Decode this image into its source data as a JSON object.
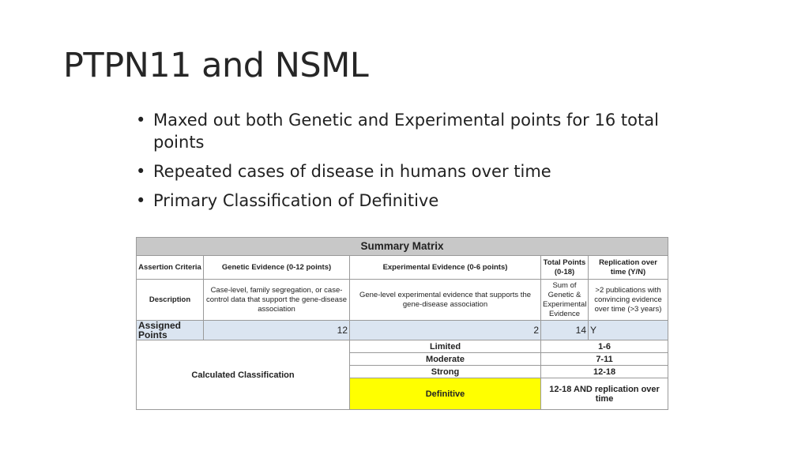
{
  "slide": {
    "title": "PTPN11 and NSML",
    "bullet_glyph": "•",
    "bullets": [
      "Maxed out both Genetic and Experimental points for 16 total points",
      "Repeated cases of disease in humans over time",
      "Primary Classification of Definitive"
    ]
  },
  "table": {
    "title": "Summary Matrix",
    "headers": {
      "criteria": "Assertion Criteria",
      "genetic": "Genetic Evidence (0-12 points)",
      "experimental": "Experimental Evidence (0-6 points)",
      "total": "Total Points (0-18)",
      "replication": "Replication over time (Y/N)"
    },
    "description": {
      "label": "Description",
      "genetic": "Case-level, family segregation, or case-control data that support the gene-disease association",
      "experimental": "Gene-level experimental evidence that supports the gene-disease association",
      "total": "Sum of Genetic & Experimental Evidence",
      "replication": ">2 publications with convincing evidence over time (>3 years)"
    },
    "assigned": {
      "label": "Assigned Points",
      "genetic": "12",
      "experimental": "2",
      "total": "14",
      "replication": "Y"
    },
    "classification": {
      "label": "Calculated Classification",
      "rows": [
        {
          "name": "Limited",
          "range": "1-6"
        },
        {
          "name": "Moderate",
          "range": "7-11"
        },
        {
          "name": "Strong",
          "range": "12-18"
        },
        {
          "name": "Definitive",
          "range": "12-18 AND replication over time"
        }
      ],
      "highlight_color": "#ffff00"
    }
  }
}
